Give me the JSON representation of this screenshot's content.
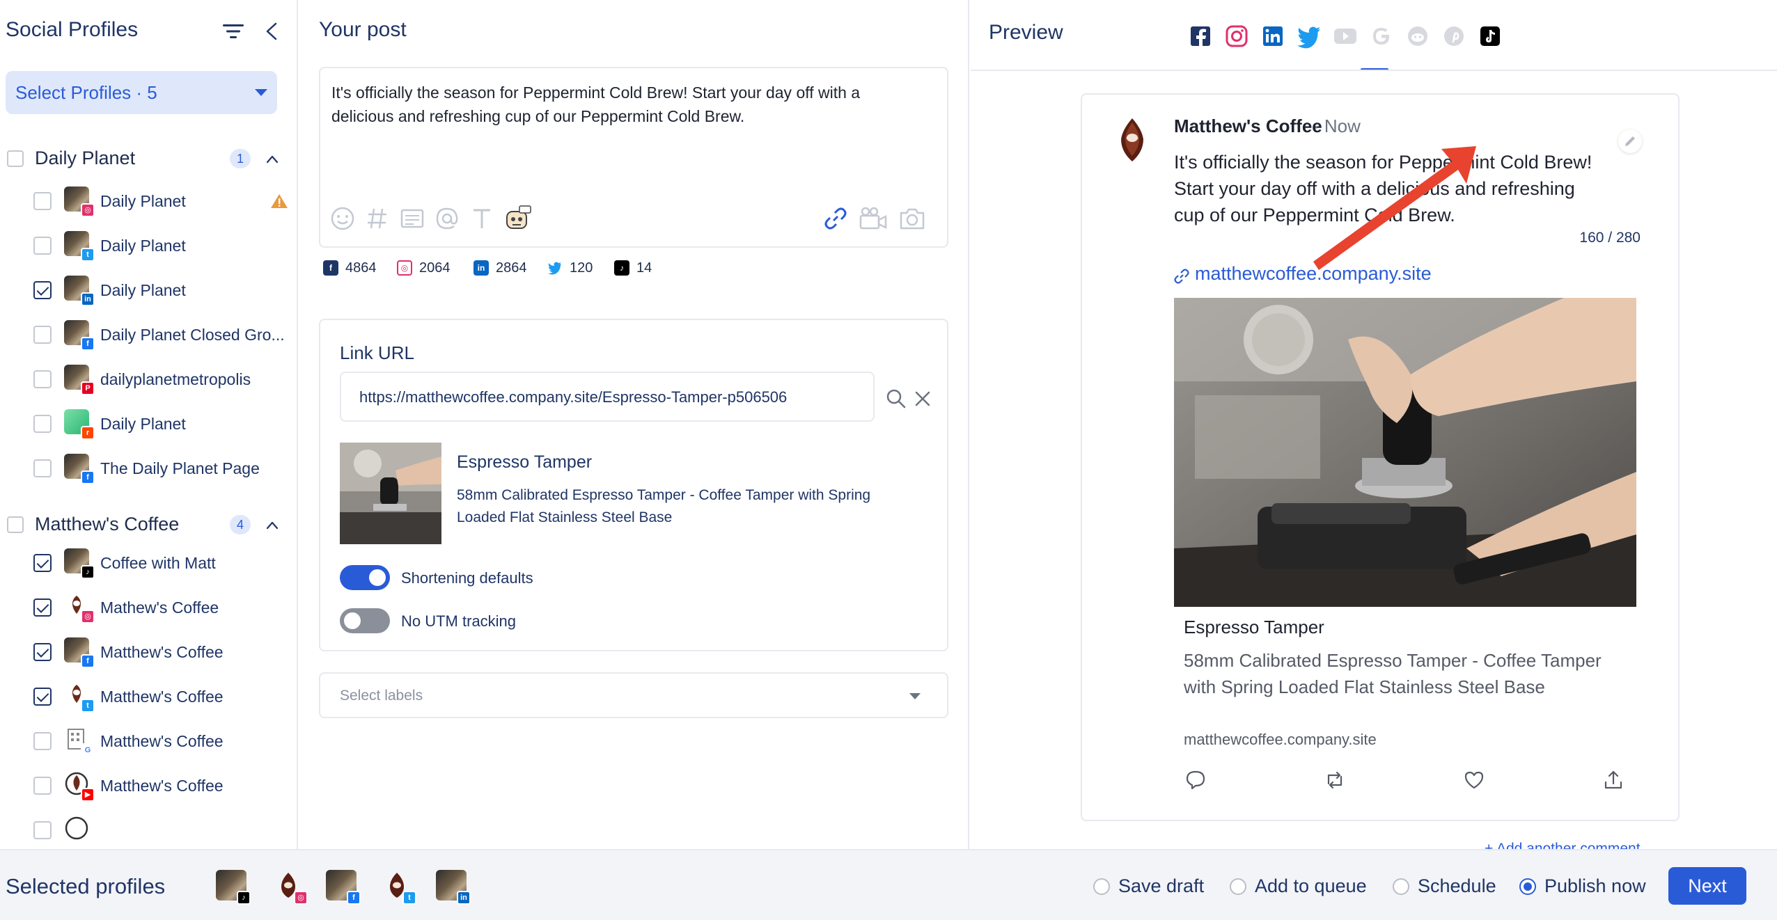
{
  "sidebar": {
    "title": "Social Profiles",
    "select_label": "Select Profiles · 5",
    "groups": [
      {
        "name": "Daily Planet",
        "count": "1",
        "profiles": [
          {
            "name": "Daily Planet",
            "network": "instagram",
            "checked": false,
            "warning": true
          },
          {
            "name": "Daily Planet",
            "network": "twitter",
            "checked": false
          },
          {
            "name": "Daily Planet",
            "network": "linkedin",
            "checked": true
          },
          {
            "name": "Daily Planet Closed Gro...",
            "network": "facebook",
            "checked": false
          },
          {
            "name": "dailyplanetmetropolis",
            "network": "pinterest",
            "checked": false
          },
          {
            "name": "Daily Planet",
            "network": "reddit",
            "checked": false
          },
          {
            "name": "The Daily Planet Page",
            "network": "facebook",
            "checked": false
          }
        ]
      },
      {
        "name": "Matthew's Coffee",
        "count": "4",
        "profiles": [
          {
            "name": "Coffee with Matt",
            "network": "tiktok",
            "checked": true
          },
          {
            "name": "Mathew's Coffee",
            "network": "instagram",
            "checked": true
          },
          {
            "name": "Matthew's Coffee",
            "network": "facebook",
            "checked": true
          },
          {
            "name": "Matthew's Coffee",
            "network": "twitter",
            "checked": true
          },
          {
            "name": "Matthew's Coffee",
            "network": "google",
            "checked": false
          },
          {
            "name": "Matthew's Coffee",
            "network": "youtube",
            "checked": false
          }
        ]
      }
    ]
  },
  "composer": {
    "title": "Your post",
    "text": "It's officially the season for Peppermint Cold Brew! Start your day off with a delicious and refreshing cup of our Peppermint Cold Brew.",
    "counts": [
      {
        "network": "facebook",
        "value": "4864"
      },
      {
        "network": "instagram",
        "value": "2064"
      },
      {
        "network": "linkedin",
        "value": "2864"
      },
      {
        "network": "twitter",
        "value": "120"
      },
      {
        "network": "tiktok",
        "value": "14"
      }
    ],
    "link": {
      "title": "Link URL",
      "url": "https://matthewcoffee.company.site/Espresso-Tamper-p506506",
      "name": "Espresso Tamper",
      "description": "58mm Calibrated Espresso Tamper - Coffee Tamper with Spring Loaded Flat Stainless Steel Base",
      "toggle_shortening": {
        "label": "Shortening defaults",
        "on": true
      },
      "toggle_utm": {
        "label": "No UTM tracking",
        "on": false
      }
    },
    "labels_placeholder": "Select labels"
  },
  "preview": {
    "title": "Preview",
    "tabs": [
      "facebook",
      "instagram",
      "linkedin",
      "twitter",
      "youtube",
      "google",
      "reddit",
      "pinterest",
      "tiktok"
    ],
    "active_tab": "twitter",
    "tweet": {
      "name": "Matthew's Coffee",
      "time": "· Now",
      "line1": "It's officially the season for Peppermint Cold Brew!",
      "line2": "Start your day off with a delicious and refreshing",
      "line3": "cup of our Peppermint Cold Brew.",
      "chars": "160 / 280",
      "link": "matthewcoffee.company.site",
      "card_name": "Espresso Tamper",
      "card_desc": "58mm Calibrated Espresso Tamper - Coffee Tamper with Spring Loaded Flat Stainless Steel Base",
      "card_domain": "matthewcoffee.company.site"
    },
    "add_comment": "+ Add another comment"
  },
  "bottom": {
    "title": "Selected profiles",
    "selected": [
      {
        "network": "tiktok"
      },
      {
        "network": "instagram"
      },
      {
        "network": "facebook"
      },
      {
        "network": "twitter"
      },
      {
        "network": "linkedin"
      }
    ],
    "options": {
      "save_draft": "Save draft",
      "add_to_queue": "Add to queue",
      "schedule": "Schedule",
      "publish_now": "Publish now"
    },
    "selected_option": "publish_now",
    "next": "Next"
  },
  "colors": {
    "accent": "#2a5bd7",
    "facebook": "#1877f2",
    "instagram": "#e1306c",
    "linkedin": "#0a66c2",
    "twitter": "#1d9bf0",
    "tiktok": "#000000",
    "youtube": "#ff0000",
    "pinterest": "#e60023",
    "reddit": "#ff4500",
    "google": "#4285f4",
    "annotation_arrow": "#e8432e"
  }
}
